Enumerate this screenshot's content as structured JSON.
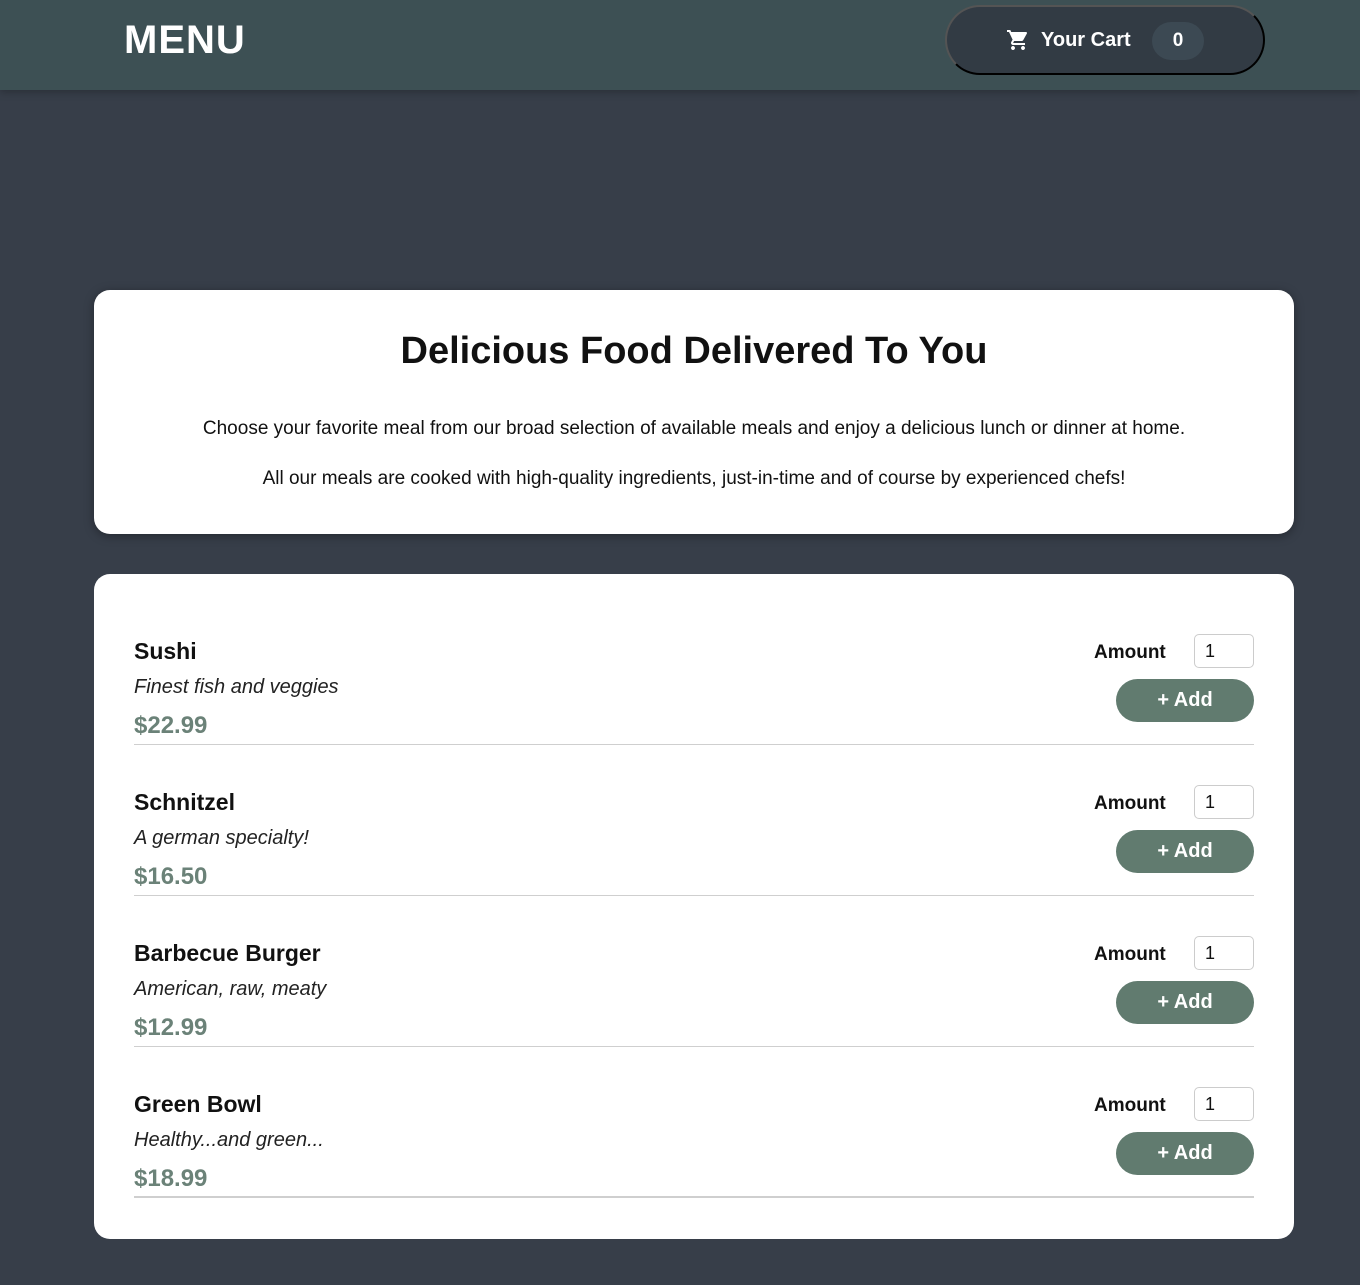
{
  "header": {
    "logo": "MENU",
    "cart": {
      "label": "Your Cart",
      "count": "0",
      "icon": "cart-icon"
    }
  },
  "summary": {
    "title": "Delicious Food Delivered To You",
    "paragraphs": [
      "Choose your favorite meal from our broad selection of available meals and enjoy a delicious lunch or dinner at home.",
      "All our meals are cooked with high-quality ingredients, just-in-time and of course by experienced chefs!"
    ]
  },
  "meals": [
    {
      "name": "Sushi",
      "description": "Finest fish and veggies",
      "price": "$22.99",
      "amount_label": "Amount",
      "amount": "1",
      "add_label": "+ Add"
    },
    {
      "name": "Schnitzel",
      "description": "A german specialty!",
      "price": "$16.50",
      "amount_label": "Amount",
      "amount": "1",
      "add_label": "+ Add"
    },
    {
      "name": "Barbecue Burger",
      "description": "American, raw, meaty",
      "price": "$12.99",
      "amount_label": "Amount",
      "amount": "1",
      "add_label": "+ Add"
    },
    {
      "name": "Green Bowl",
      "description": "Healthy...and green...",
      "price": "$18.99",
      "amount_label": "Amount",
      "amount": "1",
      "add_label": "+ Add"
    }
  ],
  "colors": {
    "background": "#373e49",
    "header": "#3d5054",
    "cart_button": "#323b44",
    "accent": "#617b6f",
    "price": "#6b8278"
  }
}
